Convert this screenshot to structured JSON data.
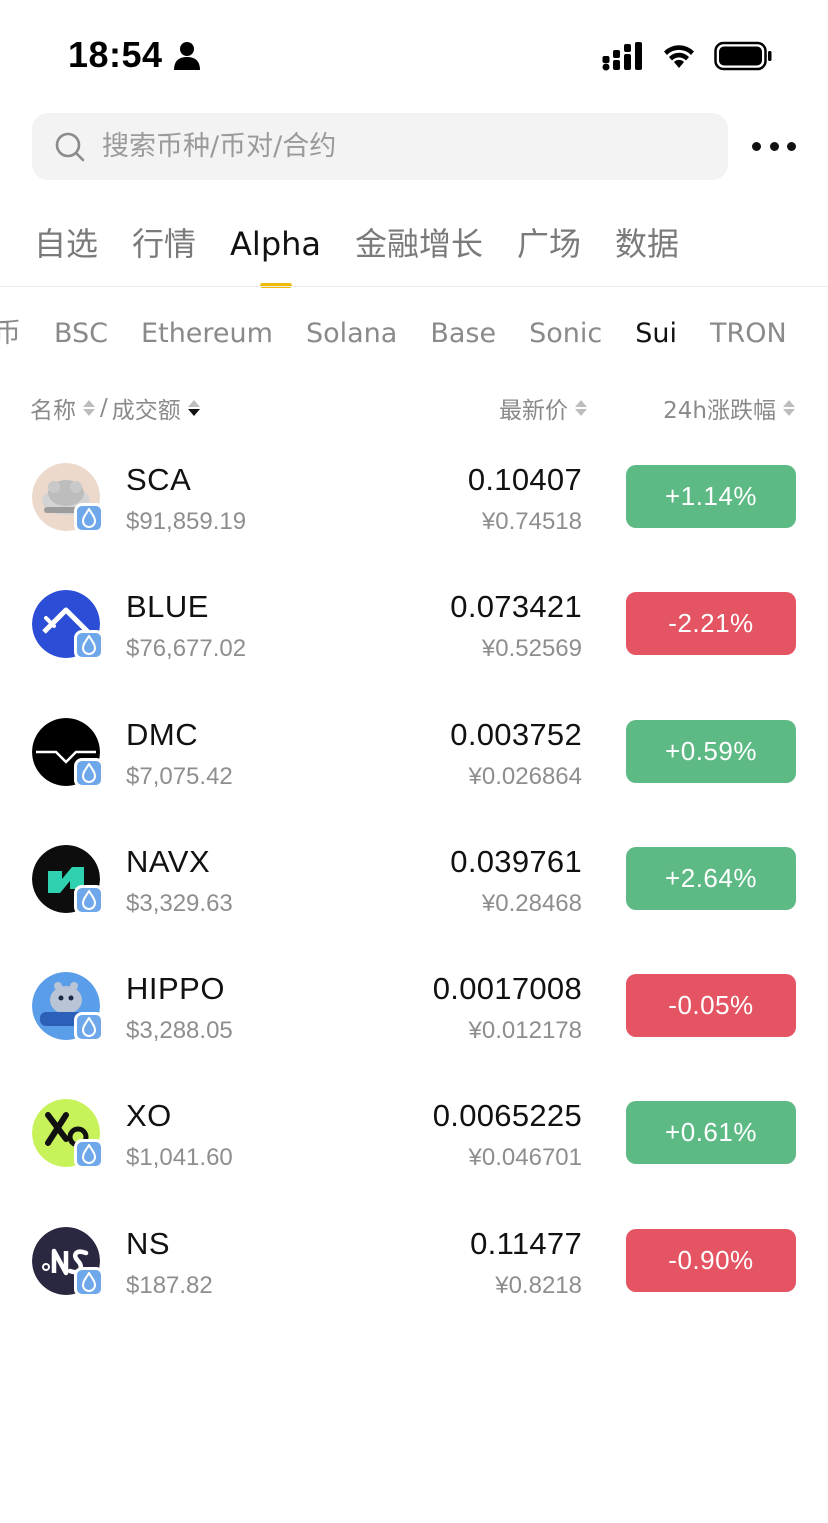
{
  "status_bar": {
    "time": "18:54"
  },
  "search": {
    "placeholder": "搜索币种/币对/合约"
  },
  "main_tabs": [
    {
      "label": "自选",
      "active": false
    },
    {
      "label": "行情",
      "active": false
    },
    {
      "label": "Alpha",
      "active": true
    },
    {
      "label": "金融增长",
      "active": false
    },
    {
      "label": "广场",
      "active": false
    },
    {
      "label": "数据",
      "active": false
    }
  ],
  "chain_tabs": [
    {
      "label": "币",
      "active": false
    },
    {
      "label": "BSC",
      "active": false
    },
    {
      "label": "Ethereum",
      "active": false
    },
    {
      "label": "Solana",
      "active": false
    },
    {
      "label": "Base",
      "active": false
    },
    {
      "label": "Sonic",
      "active": false
    },
    {
      "label": "Sui",
      "active": true
    },
    {
      "label": "TRON",
      "active": false
    }
  ],
  "columns": {
    "name": "名称",
    "separator": "/",
    "volume": "成交额",
    "price": "最新价",
    "change": "24h涨跌幅"
  },
  "tokens": [
    {
      "symbol": "SCA",
      "volume": "$91,859.19",
      "price": "0.10407",
      "cny": "¥0.74518",
      "change": "+1.14%",
      "direction": "up",
      "icon": "sca-token-icon"
    },
    {
      "symbol": "BLUE",
      "volume": "$76,677.02",
      "price": "0.073421",
      "cny": "¥0.52569",
      "change": "-2.21%",
      "direction": "down",
      "icon": "blue-token-icon"
    },
    {
      "symbol": "DMC",
      "volume": "$7,075.42",
      "price": "0.003752",
      "cny": "¥0.026864",
      "change": "+0.59%",
      "direction": "up",
      "icon": "dmc-token-icon"
    },
    {
      "symbol": "NAVX",
      "volume": "$3,329.63",
      "price": "0.039761",
      "cny": "¥0.28468",
      "change": "+2.64%",
      "direction": "up",
      "icon": "navx-token-icon"
    },
    {
      "symbol": "HIPPO",
      "volume": "$3,288.05",
      "price": "0.0017008",
      "cny": "¥0.012178",
      "change": "-0.05%",
      "direction": "down",
      "icon": "hippo-token-icon"
    },
    {
      "symbol": "XO",
      "volume": "$1,041.60",
      "price": "0.0065225",
      "cny": "¥0.046701",
      "change": "+0.61%",
      "direction": "up",
      "icon": "xo-token-icon"
    },
    {
      "symbol": "NS",
      "volume": "$187.82",
      "price": "0.11477",
      "cny": "¥0.8218",
      "change": "-0.90%",
      "direction": "down",
      "icon": "ns-token-icon"
    }
  ],
  "colors": {
    "accent": "#f0b90b",
    "up": "#5dba84",
    "down": "#e55463",
    "sui_badge": "#6fa8ea"
  }
}
